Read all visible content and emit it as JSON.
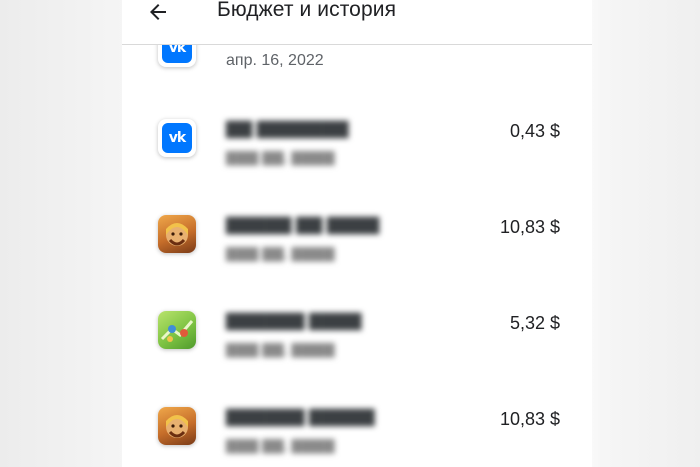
{
  "header": {
    "back_icon": "arrow-back-icon",
    "title": "Бюджет и история"
  },
  "list": {
    "items": [
      {
        "icon": "vk-icon",
        "icon_text": "vk",
        "name": "",
        "date": "апр. 16, 2022",
        "price": ""
      },
      {
        "icon": "vk-icon",
        "icon_text": "vk",
        "name": "",
        "date": "",
        "price": "0,43 $"
      },
      {
        "icon": "clash-of-clans-icon",
        "name": "",
        "date": "",
        "price": "10,83 $"
      },
      {
        "icon": "green-game-icon",
        "name": "",
        "date": "",
        "price": "5,32 $"
      },
      {
        "icon": "clash-of-clans-icon",
        "name": "",
        "date": "",
        "price": "10,83 $"
      }
    ]
  },
  "colors": {
    "vk_blue": "#0077ff",
    "text_primary": "#202124",
    "text_secondary": "#5f6368",
    "divider": "#d9d9d9"
  }
}
